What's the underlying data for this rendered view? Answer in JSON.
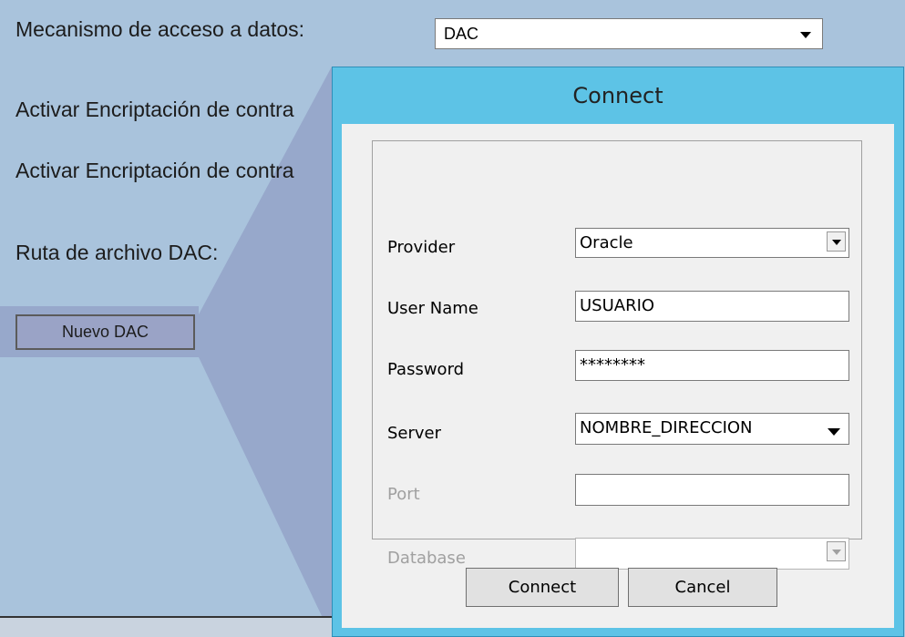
{
  "background": {
    "data_access_label": "Mecanismo de acceso a datos:",
    "data_access_value": "DAC",
    "encryption_label_1": "Activar Encriptación de contra",
    "encryption_label_2": "Activar Encriptación de contra",
    "dac_path_label": "Ruta de archivo DAC:",
    "new_dac_button": "Nuevo DAC"
  },
  "dialog": {
    "title": "Connect",
    "fields": {
      "provider": {
        "label": "Provider",
        "value": "Oracle"
      },
      "user_name": {
        "label": "User Name",
        "value": "USUARIO"
      },
      "password": {
        "label": "Password",
        "value": "********"
      },
      "server": {
        "label": "Server",
        "value": "NOMBRE_DIRECCION"
      },
      "port": {
        "label": "Port",
        "value": ""
      },
      "database": {
        "label": "Database",
        "value": ""
      }
    },
    "buttons": {
      "connect": "Connect",
      "cancel": "Cancel"
    }
  },
  "colors": {
    "background": "#a9c3dc",
    "callout": "#97a8cb",
    "dialog_frame": "#5dc3e6",
    "dialog_body": "#f0f0f0"
  },
  "icons": [
    "dropdown-arrow-icon"
  ]
}
